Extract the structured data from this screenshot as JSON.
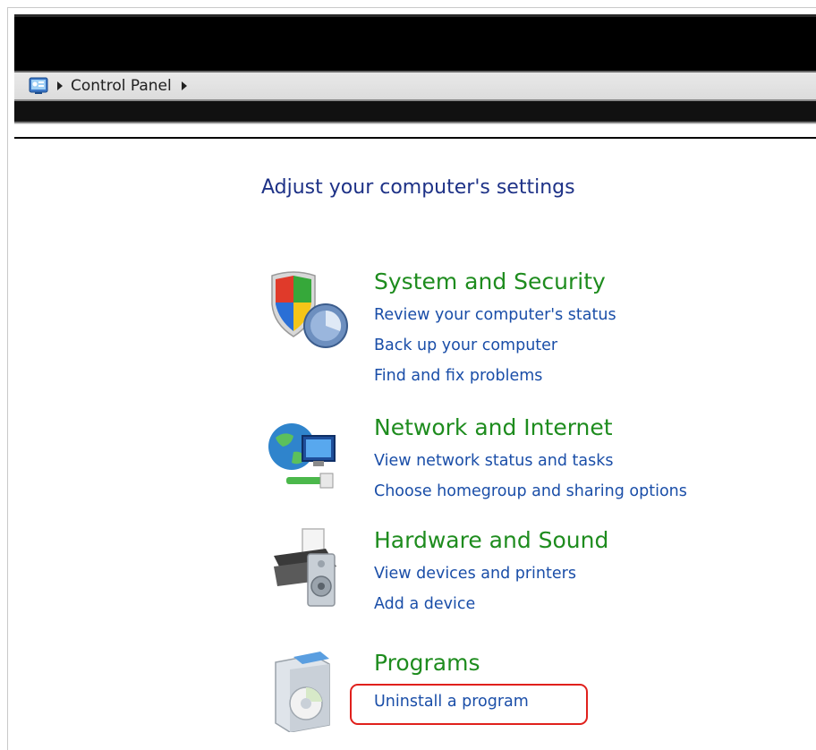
{
  "address_bar": {
    "icon": "control-panel-icon",
    "breadcrumb": [
      "Control Panel"
    ]
  },
  "page_title": "Adjust your computer's settings",
  "categories": [
    {
      "title": "System and Security",
      "icon": "shield-icon",
      "links": [
        "Review your computer's status",
        "Back up your computer",
        "Find and fix problems"
      ]
    },
    {
      "title": "Network and Internet",
      "icon": "network-globe-icon",
      "links": [
        "View network status and tasks",
        "Choose homegroup and sharing options"
      ]
    },
    {
      "title": "Hardware and Sound",
      "icon": "printer-speaker-icon",
      "links": [
        "View devices and printers",
        "Add a device"
      ]
    },
    {
      "title": "Programs",
      "icon": "programs-box-icon",
      "links": [
        "Uninstall a program"
      ]
    }
  ],
  "highlight": {
    "target": "Uninstall a program",
    "color": "#e0201c"
  },
  "colors": {
    "title": "#1e3287",
    "category": "#1e8c1e",
    "link": "#1a4ea8"
  }
}
